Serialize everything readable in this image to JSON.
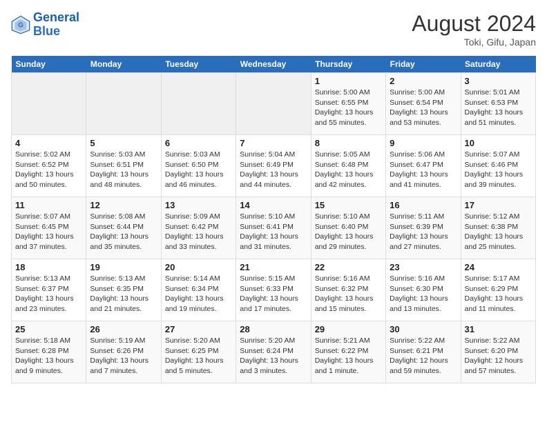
{
  "header": {
    "logo_general": "General",
    "logo_blue": "Blue",
    "main_title": "August 2024",
    "sub_title": "Toki, Gifu, Japan"
  },
  "weekdays": [
    "Sunday",
    "Monday",
    "Tuesday",
    "Wednesday",
    "Thursday",
    "Friday",
    "Saturday"
  ],
  "weeks": [
    [
      {
        "day": "",
        "info": ""
      },
      {
        "day": "",
        "info": ""
      },
      {
        "day": "",
        "info": ""
      },
      {
        "day": "",
        "info": ""
      },
      {
        "day": "1",
        "info": "Sunrise: 5:00 AM\nSunset: 6:55 PM\nDaylight: 13 hours\nand 55 minutes."
      },
      {
        "day": "2",
        "info": "Sunrise: 5:00 AM\nSunset: 6:54 PM\nDaylight: 13 hours\nand 53 minutes."
      },
      {
        "day": "3",
        "info": "Sunrise: 5:01 AM\nSunset: 6:53 PM\nDaylight: 13 hours\nand 51 minutes."
      }
    ],
    [
      {
        "day": "4",
        "info": "Sunrise: 5:02 AM\nSunset: 6:52 PM\nDaylight: 13 hours\nand 50 minutes."
      },
      {
        "day": "5",
        "info": "Sunrise: 5:03 AM\nSunset: 6:51 PM\nDaylight: 13 hours\nand 48 minutes."
      },
      {
        "day": "6",
        "info": "Sunrise: 5:03 AM\nSunset: 6:50 PM\nDaylight: 13 hours\nand 46 minutes."
      },
      {
        "day": "7",
        "info": "Sunrise: 5:04 AM\nSunset: 6:49 PM\nDaylight: 13 hours\nand 44 minutes."
      },
      {
        "day": "8",
        "info": "Sunrise: 5:05 AM\nSunset: 6:48 PM\nDaylight: 13 hours\nand 42 minutes."
      },
      {
        "day": "9",
        "info": "Sunrise: 5:06 AM\nSunset: 6:47 PM\nDaylight: 13 hours\nand 41 minutes."
      },
      {
        "day": "10",
        "info": "Sunrise: 5:07 AM\nSunset: 6:46 PM\nDaylight: 13 hours\nand 39 minutes."
      }
    ],
    [
      {
        "day": "11",
        "info": "Sunrise: 5:07 AM\nSunset: 6:45 PM\nDaylight: 13 hours\nand 37 minutes."
      },
      {
        "day": "12",
        "info": "Sunrise: 5:08 AM\nSunset: 6:44 PM\nDaylight: 13 hours\nand 35 minutes."
      },
      {
        "day": "13",
        "info": "Sunrise: 5:09 AM\nSunset: 6:42 PM\nDaylight: 13 hours\nand 33 minutes."
      },
      {
        "day": "14",
        "info": "Sunrise: 5:10 AM\nSunset: 6:41 PM\nDaylight: 13 hours\nand 31 minutes."
      },
      {
        "day": "15",
        "info": "Sunrise: 5:10 AM\nSunset: 6:40 PM\nDaylight: 13 hours\nand 29 minutes."
      },
      {
        "day": "16",
        "info": "Sunrise: 5:11 AM\nSunset: 6:39 PM\nDaylight: 13 hours\nand 27 minutes."
      },
      {
        "day": "17",
        "info": "Sunrise: 5:12 AM\nSunset: 6:38 PM\nDaylight: 13 hours\nand 25 minutes."
      }
    ],
    [
      {
        "day": "18",
        "info": "Sunrise: 5:13 AM\nSunset: 6:37 PM\nDaylight: 13 hours\nand 23 minutes."
      },
      {
        "day": "19",
        "info": "Sunrise: 5:13 AM\nSunset: 6:35 PM\nDaylight: 13 hours\nand 21 minutes."
      },
      {
        "day": "20",
        "info": "Sunrise: 5:14 AM\nSunset: 6:34 PM\nDaylight: 13 hours\nand 19 minutes."
      },
      {
        "day": "21",
        "info": "Sunrise: 5:15 AM\nSunset: 6:33 PM\nDaylight: 13 hours\nand 17 minutes."
      },
      {
        "day": "22",
        "info": "Sunrise: 5:16 AM\nSunset: 6:32 PM\nDaylight: 13 hours\nand 15 minutes."
      },
      {
        "day": "23",
        "info": "Sunrise: 5:16 AM\nSunset: 6:30 PM\nDaylight: 13 hours\nand 13 minutes."
      },
      {
        "day": "24",
        "info": "Sunrise: 5:17 AM\nSunset: 6:29 PM\nDaylight: 13 hours\nand 11 minutes."
      }
    ],
    [
      {
        "day": "25",
        "info": "Sunrise: 5:18 AM\nSunset: 6:28 PM\nDaylight: 13 hours\nand 9 minutes."
      },
      {
        "day": "26",
        "info": "Sunrise: 5:19 AM\nSunset: 6:26 PM\nDaylight: 13 hours\nand 7 minutes."
      },
      {
        "day": "27",
        "info": "Sunrise: 5:20 AM\nSunset: 6:25 PM\nDaylight: 13 hours\nand 5 minutes."
      },
      {
        "day": "28",
        "info": "Sunrise: 5:20 AM\nSunset: 6:24 PM\nDaylight: 13 hours\nand 3 minutes."
      },
      {
        "day": "29",
        "info": "Sunrise: 5:21 AM\nSunset: 6:22 PM\nDaylight: 13 hours\nand 1 minute."
      },
      {
        "day": "30",
        "info": "Sunrise: 5:22 AM\nSunset: 6:21 PM\nDaylight: 12 hours\nand 59 minutes."
      },
      {
        "day": "31",
        "info": "Sunrise: 5:22 AM\nSunset: 6:20 PM\nDaylight: 12 hours\nand 57 minutes."
      }
    ]
  ]
}
